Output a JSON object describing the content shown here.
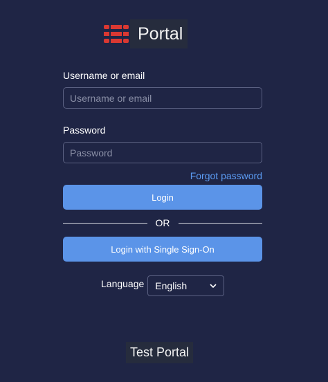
{
  "brand": {
    "logo_icon": "fortinet-logo-icon",
    "accent_color": "#da3832",
    "title": "Portal"
  },
  "login_form": {
    "username_label": "Username or email",
    "username_placeholder": "Username or email",
    "username_value": "",
    "password_label": "Password",
    "password_placeholder": "Password",
    "password_value": "",
    "forgot_password": "Forgot password",
    "login_button": "Login",
    "separator": "OR",
    "sso_button": "Login with Single Sign-On"
  },
  "language": {
    "label": "Language",
    "selected": "English",
    "icon": "chevron-down-icon"
  },
  "footer": {
    "text": "Test Portal"
  },
  "colors": {
    "background": "#1f2545",
    "button": "#5b94e8",
    "link": "#5b9bf2"
  }
}
